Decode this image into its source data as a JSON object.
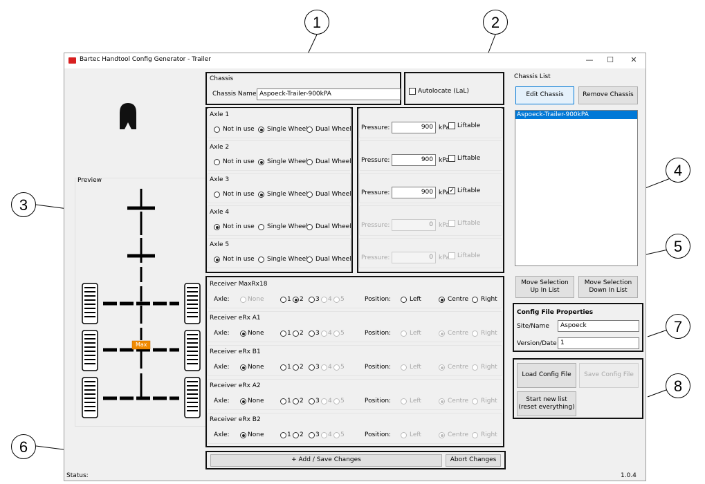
{
  "window": {
    "title": "Bartec Handtool Config Generator - Trailer",
    "minimize": "—",
    "maximize": "☐",
    "close": "✕"
  },
  "preview": {
    "title": "Preview",
    "max_label": "Max"
  },
  "chassis": {
    "group": "Chassis",
    "name_label": "Chassis Name:",
    "name_value": "Aspoeck-Trailer-900kPA"
  },
  "autolocate": {
    "label": "Autolocate (LaL)",
    "checked": false
  },
  "axles": [
    {
      "title": "Axle 1",
      "mode": "single",
      "pressure": "900",
      "liftable": false,
      "enabled": true
    },
    {
      "title": "Axle 2",
      "mode": "single",
      "pressure": "900",
      "liftable": false,
      "enabled": true
    },
    {
      "title": "Axle 3",
      "mode": "single",
      "pressure": "900",
      "liftable": true,
      "enabled": true
    },
    {
      "title": "Axle 4",
      "mode": "notinuse",
      "pressure": "0",
      "liftable": false,
      "enabled": false
    },
    {
      "title": "Axle 5",
      "mode": "notinuse",
      "pressure": "0",
      "liftable": false,
      "enabled": false
    }
  ],
  "axle_labels": {
    "not_in_use": "Not in use",
    "single": "Single Wheel",
    "dual": "Dual Wheel",
    "pressure": "Pressure:",
    "unit": "kPa",
    "liftable": "Liftable"
  },
  "receivers": [
    {
      "title": "Receiver MaxRx18",
      "axle": "2",
      "position": "Centre",
      "position_enabled": true
    },
    {
      "title": "Receiver eRx A1",
      "axle": "None",
      "position": "Centre",
      "position_enabled": false
    },
    {
      "title": "Receiver eRx B1",
      "axle": "None",
      "position": "Centre",
      "position_enabled": false
    },
    {
      "title": "Receiver eRx A2",
      "axle": "None",
      "position": "Centre",
      "position_enabled": false
    },
    {
      "title": "Receiver eRx B2",
      "axle": "None",
      "position": "Centre",
      "position_enabled": false
    }
  ],
  "receiver_labels": {
    "axle": "Axle:",
    "position": "Position:",
    "axle_options": [
      "None",
      "1",
      "2",
      "3",
      "4",
      "5"
    ],
    "position_options": [
      "Left",
      "Centre",
      "Right"
    ]
  },
  "actions": {
    "add_save": "+ Add / Save Changes",
    "abort": "Abort Changes"
  },
  "chassis_list": {
    "title": "Chassis List",
    "edit": "Edit Chassis",
    "remove": "Remove Chassis",
    "items": [
      "Aspoeck-Trailer-900kPA"
    ],
    "move_up": "Move Selection Up In List",
    "move_down": "Move Selection Down In List"
  },
  "config": {
    "title": "Config File Properties",
    "site_label": "Site/Name",
    "site_value": "Aspoeck",
    "version_label": "Version/Date",
    "version_value": "1"
  },
  "file_buttons": {
    "load": "Load Config File",
    "save": "Save Config File",
    "reset": "Start new list (reset everything)"
  },
  "status": {
    "label": "Status:",
    "version": "1.0.4"
  },
  "callouts": [
    "1",
    "2",
    "3",
    "4",
    "5",
    "6",
    "7",
    "8"
  ],
  "colors": {
    "accent": "#0078d7",
    "selection": "#0078d7",
    "max_badge": "#f08a00",
    "icon_red": "#d82020"
  }
}
